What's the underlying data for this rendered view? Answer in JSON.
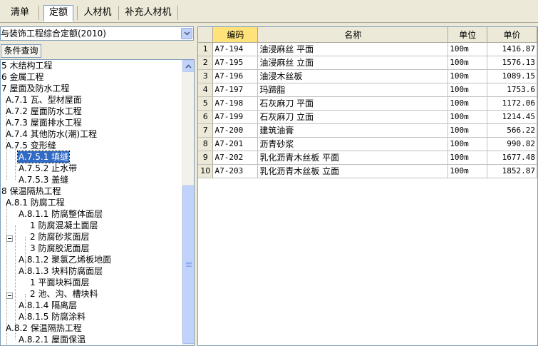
{
  "tabs": [
    {
      "label": "清单",
      "active": false
    },
    {
      "label": "定额",
      "active": true
    },
    {
      "label": "人材机",
      "active": false
    },
    {
      "label": "补充人材机",
      "active": false
    }
  ],
  "quota_book": {
    "selected": "与装饰工程综合定额(2010)"
  },
  "query_button": "条件查询",
  "tree": [
    {
      "label": "5 木结构工程",
      "level": 0
    },
    {
      "label": "6 金属工程",
      "level": 0
    },
    {
      "label": "7 屋面及防水工程",
      "level": 0
    },
    {
      "label": "A.7.1 瓦、型材屋面",
      "level": 1
    },
    {
      "label": "A.7.2 屋面防水工程",
      "level": 1
    },
    {
      "label": "A.7.3 屋面排水工程",
      "level": 1
    },
    {
      "label": "A.7.4 其他防水(潮)工程",
      "level": 1
    },
    {
      "label": "A.7.5 变形缝",
      "level": 1
    },
    {
      "label": "A.7.5.1 填缝",
      "level": 2,
      "selected": true
    },
    {
      "label": "A.7.5.2 止水带",
      "level": 2
    },
    {
      "label": "A.7.5.3 盖缝",
      "level": 2
    },
    {
      "label": "8 保温隔热工程",
      "level": 0
    },
    {
      "label": "A.8.1 防腐工程",
      "level": 1
    },
    {
      "label": "A.8.1.1 防腐整体面层",
      "level": 2,
      "expander": true
    },
    {
      "label": "1 防腐混凝土面层",
      "level": 3
    },
    {
      "label": "2 防腐砂浆面层",
      "level": 3
    },
    {
      "label": "3 防腐胶泥面层",
      "level": 3
    },
    {
      "label": "A.8.1.2 聚氯乙烯板地面",
      "level": 2
    },
    {
      "label": "A.8.1.3 块料防腐面层",
      "level": 2,
      "expander": true
    },
    {
      "label": "1 平面块料面层",
      "level": 3
    },
    {
      "label": "2 池、沟、槽块料",
      "level": 3
    },
    {
      "label": "A.8.1.4 隔离层",
      "level": 2
    },
    {
      "label": "A.8.1.5 防腐涂料",
      "level": 2
    },
    {
      "label": "A.8.2 保温隔热工程",
      "level": 1
    },
    {
      "label": "A.8.2.1 屋面保温",
      "level": 2
    }
  ],
  "grid": {
    "headers": {
      "code": "编码",
      "name": "名称",
      "unit": "单位",
      "price": "单价"
    },
    "rows": [
      {
        "no": "1",
        "code": "A7-194",
        "name": "油浸麻丝 平面",
        "unit": "100m",
        "price": "1416.87"
      },
      {
        "no": "2",
        "code": "A7-195",
        "name": "油浸麻丝 立面",
        "unit": "100m",
        "price": "1576.13"
      },
      {
        "no": "3",
        "code": "A7-196",
        "name": "油浸木丝板",
        "unit": "100m",
        "price": "1089.15"
      },
      {
        "no": "4",
        "code": "A7-197",
        "name": "玛蹄脂",
        "unit": "100m",
        "price": "1753.6"
      },
      {
        "no": "5",
        "code": "A7-198",
        "name": "石灰麻刀 平面",
        "unit": "100m",
        "price": "1172.06"
      },
      {
        "no": "6",
        "code": "A7-199",
        "name": "石灰麻刀 立面",
        "unit": "100m",
        "price": "1214.45"
      },
      {
        "no": "7",
        "code": "A7-200",
        "name": "建筑油膏",
        "unit": "100m",
        "price": "566.22"
      },
      {
        "no": "8",
        "code": "A7-201",
        "name": "沥青砂浆",
        "unit": "100m",
        "price": "990.82"
      },
      {
        "no": "9",
        "code": "A7-202",
        "name": "乳化沥青木丝板 平面",
        "unit": "100m",
        "price": "1677.48"
      },
      {
        "no": "10",
        "code": "A7-203",
        "name": "乳化沥青木丝板 立面",
        "unit": "100m",
        "price": "1852.87"
      }
    ]
  }
}
